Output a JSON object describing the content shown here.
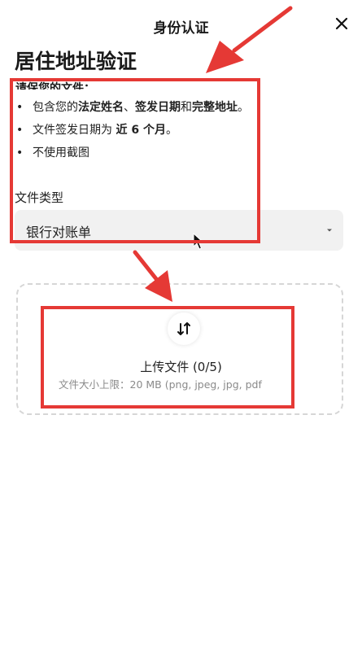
{
  "header": {
    "title": "身份认证"
  },
  "page": {
    "title": "居住地址验证"
  },
  "requirements": {
    "intro": "请保您的文件：",
    "items": [
      {
        "pre": "包含您的",
        "b1": "法定姓名",
        "mid1": "、",
        "b2": "签发日期",
        "mid2": "和",
        "b3": "完整地址",
        "post": "。"
      },
      {
        "pre": "文件签发日期为 ",
        "b1": "近 6 个月",
        "post": "。"
      },
      {
        "text": "不使用截图"
      }
    ]
  },
  "document_type": {
    "label": "文件类型",
    "selected": "银行对账单"
  },
  "upload": {
    "title": "上传文件 (0/5)",
    "hint": "文件大小上限：20 MB (png, jpeg, jpg, pdf"
  },
  "icons": {
    "close": "close-icon",
    "chevron": "chevron-down-icon",
    "upload": "upload-arrows-icon",
    "cursor": "mouse-cursor-icon"
  },
  "colors": {
    "highlight": "#e53935",
    "select_bg": "#f1f1f1",
    "dashed_border": "#d6d6d6",
    "hint_text": "#8a8a8a"
  }
}
